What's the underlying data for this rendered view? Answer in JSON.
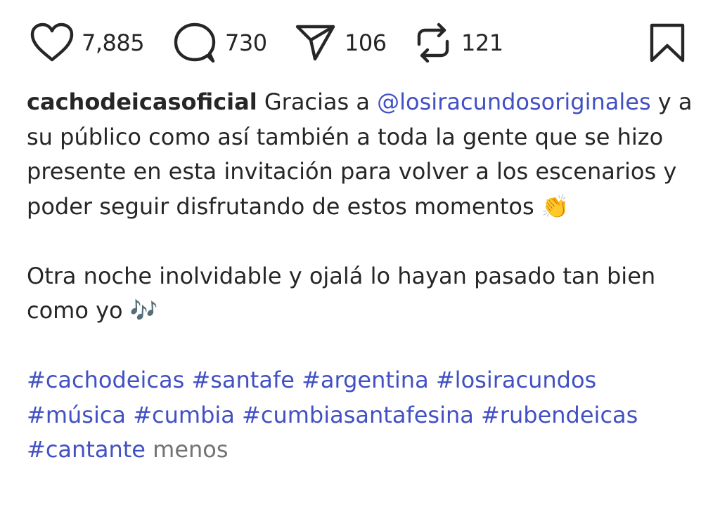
{
  "actions": {
    "likes": "7,885",
    "comments": "730",
    "shares": "106",
    "reposts": "121"
  },
  "caption": {
    "username": "cachodeicasoficial",
    "text_1": "Gracias a",
    "mention": "@losiracundosoriginales",
    "text_2": "y a su público como así también a toda la gente que se hizo presente en esta invitación para volver a los escenarios y poder seguir disfrutando de estos momentos",
    "emoji_1": "👏",
    "paragraph_2": "Otra noche inolvidable y ojalá lo hayan pasado tan bien como yo",
    "emoji_2": "🎶",
    "hashtags": [
      "#cachodeicas",
      "#santafe",
      "#argentina",
      "#losiracundos",
      "#música",
      "#cumbia",
      "#cumbiasantafesina",
      "#rubendeicas",
      "#cantante"
    ],
    "less_label": "menos"
  },
  "colors": {
    "text": "#262626",
    "link": "#4150c3",
    "muted": "#737373"
  },
  "icons": [
    "heart-icon",
    "comment-icon",
    "share-icon",
    "repost-icon",
    "bookmark-icon"
  ]
}
